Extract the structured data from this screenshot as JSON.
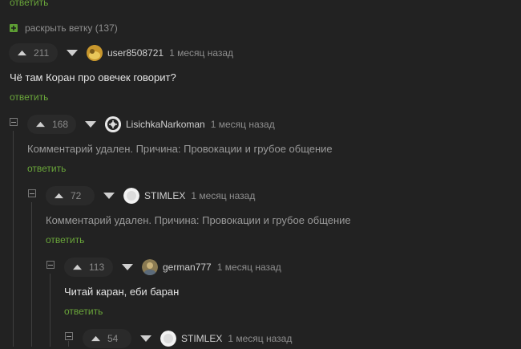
{
  "top_reply_label": "ответить",
  "expand": {
    "label": "раскрыть ветку (137)"
  },
  "comments": [
    {
      "score": "211",
      "user": "user8508721",
      "time": "1 месяц назад",
      "text": "Чё там Коран про овечек говорит?",
      "reply": "ответить",
      "deleted": false
    },
    {
      "score": "168",
      "user": "LisichkaNarkoman",
      "time": "1 месяц назад",
      "text": "Комментарий удален. Причина: Провокации и грубое общение",
      "reply": "ответить",
      "deleted": true
    },
    {
      "score": "72",
      "user": "STIMLEX",
      "time": "1 месяц назад",
      "text": "Комментарий удален. Причина: Провокации и грубое общение",
      "reply": "ответить",
      "deleted": true
    },
    {
      "score": "113",
      "user": "german777",
      "time": "1 месяц назад",
      "text": "Читай каран, еби баран",
      "reply": "ответить",
      "deleted": false
    },
    {
      "score": "54",
      "user": "STIMLEX",
      "time": "1 месяц назад"
    }
  ],
  "colors": {
    "background": "#222222",
    "reply_green": "#6aa63a",
    "expand_green": "#5d9e34"
  },
  "icons": [
    "arrow-up-icon",
    "arrow-down-icon",
    "collapse-minus-icon",
    "expand-plus-icon",
    "avatar"
  ]
}
